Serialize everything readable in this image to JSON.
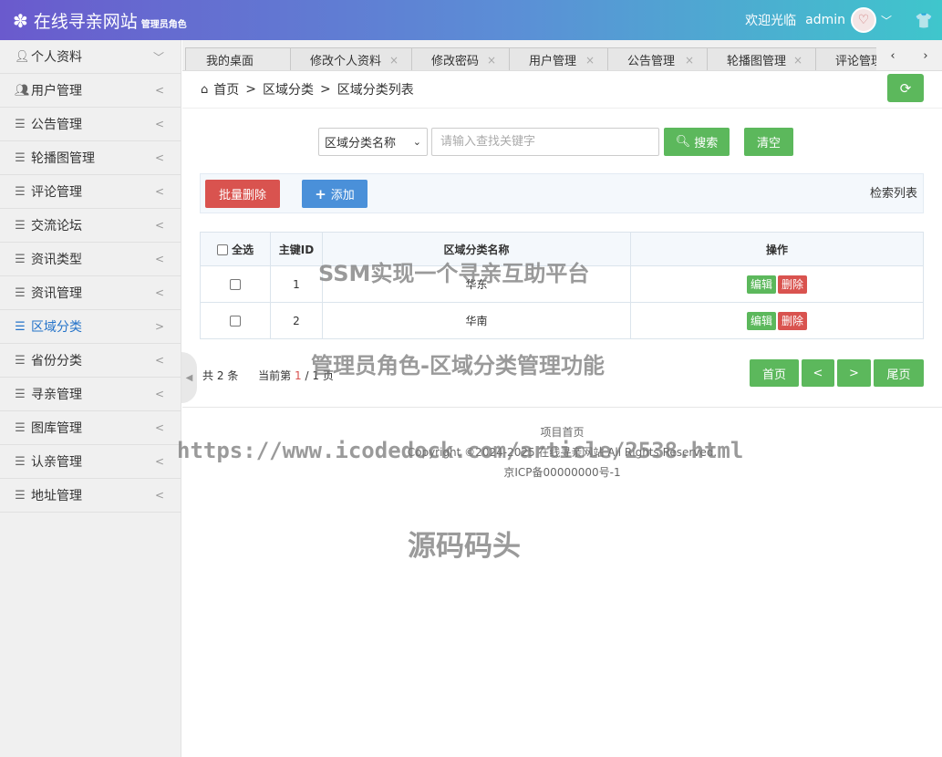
{
  "header": {
    "site_title": "在线寻亲网站",
    "role_label": "管理员角色",
    "welcome": "欢迎光临",
    "username": "admin"
  },
  "sidebar": {
    "items": [
      {
        "label": "个人资料",
        "icon": "user-icon",
        "arrow": "﹀"
      },
      {
        "label": "用户管理",
        "icon": "users-icon",
        "arrow": "<"
      },
      {
        "label": "公告管理",
        "icon": "list-icon",
        "arrow": "<"
      },
      {
        "label": "轮播图管理",
        "icon": "list-icon",
        "arrow": "<"
      },
      {
        "label": "评论管理",
        "icon": "list-icon",
        "arrow": "<"
      },
      {
        "label": "交流论坛",
        "icon": "list-icon",
        "arrow": "<"
      },
      {
        "label": "资讯类型",
        "icon": "list-icon",
        "arrow": "<"
      },
      {
        "label": "资讯管理",
        "icon": "list-icon",
        "arrow": "<"
      },
      {
        "label": "区域分类",
        "icon": "list-icon",
        "arrow": ">",
        "active": true
      },
      {
        "label": "省份分类",
        "icon": "list-icon",
        "arrow": "<"
      },
      {
        "label": "寻亲管理",
        "icon": "list-icon",
        "arrow": "<"
      },
      {
        "label": "图库管理",
        "icon": "list-icon",
        "arrow": "<"
      },
      {
        "label": "认亲管理",
        "icon": "list-icon",
        "arrow": "<"
      },
      {
        "label": "地址管理",
        "icon": "list-icon",
        "arrow": "<"
      }
    ]
  },
  "tabs": [
    {
      "label": "我的桌面",
      "closable": false
    },
    {
      "label": "修改个人资料",
      "closable": true
    },
    {
      "label": "修改密码",
      "closable": true
    },
    {
      "label": "用户管理",
      "closable": true
    },
    {
      "label": "公告管理",
      "closable": true
    },
    {
      "label": "轮播图管理",
      "closable": true
    },
    {
      "label": "评论管理",
      "closable": false
    }
  ],
  "breadcrumb": {
    "home": "首页",
    "level1": "区域分类",
    "level2": "区域分类列表",
    "sep": ">"
  },
  "search": {
    "field_selected": "区域分类名称",
    "placeholder": "请输入查找关键字",
    "search_label": "搜索",
    "clear_label": "清空"
  },
  "toolbar": {
    "batch_delete_label": "批量删除",
    "add_label": "添加",
    "right_text": "检索列表"
  },
  "table": {
    "headers": {
      "select_all": "全选",
      "id": "主键ID",
      "name": "区域分类名称",
      "ops": "操作"
    },
    "rows": [
      {
        "id": "1",
        "name": "华东",
        "edit": "编辑",
        "delete": "删除"
      },
      {
        "id": "2",
        "name": "华南",
        "edit": "编辑",
        "delete": "删除"
      }
    ]
  },
  "pagination": {
    "total_prefix": "共",
    "total": "2",
    "total_suffix": "条",
    "current_prefix": "当前第",
    "current": "1",
    "slash": "/",
    "pages": "1",
    "pages_suffix": "页",
    "first": "首页",
    "prev": "<",
    "next": ">",
    "last": "尾页"
  },
  "footer": {
    "link": "项目首页",
    "copyright": "Copyright ©2024-2025 在线寻亲网站 All Rights Reserved.",
    "icp": "京ICP备00000000号-1"
  },
  "watermarks": {
    "w1": "SSM实现一个寻亲互助平台",
    "w2": "管理员角色-区域分类管理功能",
    "w3": "https://www.icodedock.com/article/2538.html",
    "w4": "源码码头"
  },
  "colors": {
    "primary_green": "#5cb85c",
    "danger_red": "#d9534f",
    "primary_blue": "#4a90d9",
    "active_link": "#2573c9"
  }
}
